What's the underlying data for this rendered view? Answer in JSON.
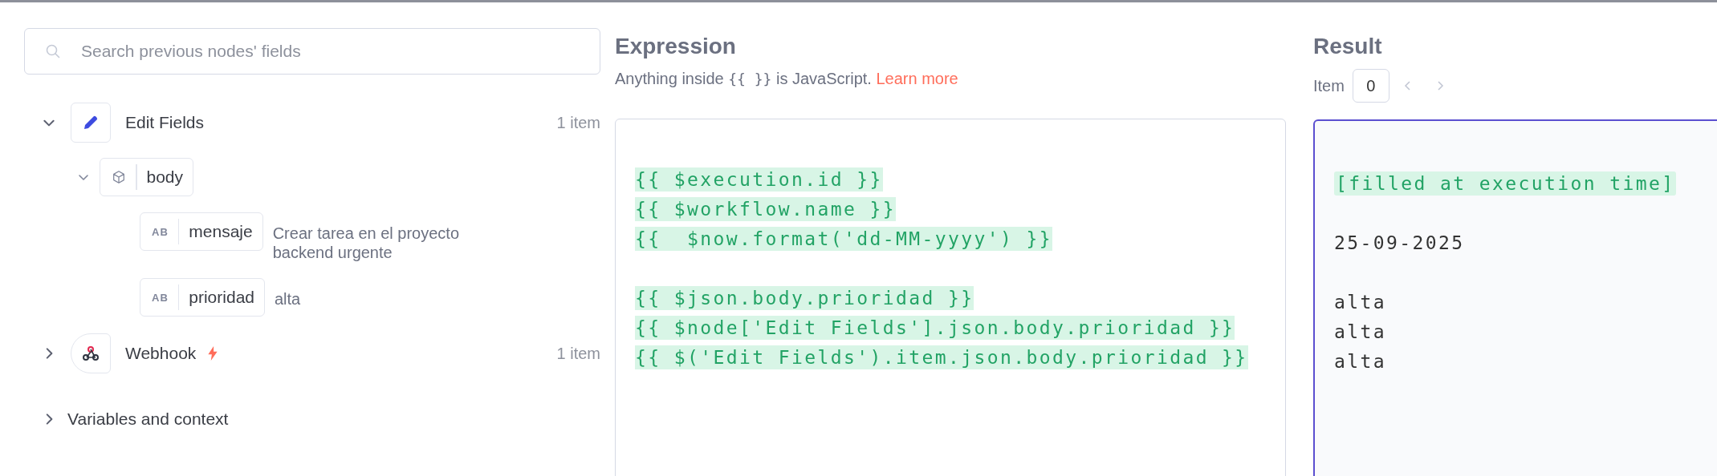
{
  "search": {
    "placeholder": "Search previous nodes' fields"
  },
  "nodes": [
    {
      "name": "Edit Fields",
      "kind": "pencil",
      "trigger": false,
      "count": "1 item",
      "expanded": true,
      "children": [
        {
          "name": "body",
          "kind": "object",
          "expanded": true,
          "children": [
            {
              "name": "mensaje",
              "kind": "string",
              "type_label": "AB",
              "value": "Crear tarea en el proyecto backend urgente"
            },
            {
              "name": "prioridad",
              "kind": "string",
              "type_label": "AB",
              "value": "alta"
            }
          ]
        }
      ]
    },
    {
      "name": "Webhook",
      "kind": "webhook",
      "trigger": true,
      "count": "1 item",
      "expanded": false
    }
  ],
  "context": {
    "label": "Variables and context",
    "expanded": false
  },
  "expression": {
    "title": "Expression",
    "hint_before": "Anything inside ",
    "hint_code": "{{ }}",
    "hint_after": " is JavaScript. ",
    "link": "Learn more",
    "lines": [
      {
        "kind": "code",
        "text": "{{ $execution.id }}"
      },
      {
        "kind": "code",
        "text": "{{ $workflow.name }}"
      },
      {
        "kind": "code",
        "text": "{{  $now.format('dd-MM-yyyy') }}"
      },
      {
        "kind": "blank"
      },
      {
        "kind": "code",
        "text": "{{ $json.body.prioridad }}"
      },
      {
        "kind": "code",
        "text": "{{ $node['Edit Fields'].json.body.prioridad }}"
      },
      {
        "kind": "code",
        "text": "{{ $('Edit Fields').item.json.body.prioridad }}"
      }
    ]
  },
  "result": {
    "title": "Result",
    "item_label": "Item",
    "item_index": "0",
    "lines": [
      {
        "kind": "pending",
        "text": "[filled at execution time]"
      },
      {
        "kind": "blank"
      },
      {
        "kind": "value",
        "text": "25-09-2025"
      },
      {
        "kind": "blank"
      },
      {
        "kind": "value",
        "text": "alta"
      },
      {
        "kind": "value",
        "text": "alta"
      },
      {
        "kind": "value",
        "text": "alta"
      }
    ]
  }
}
